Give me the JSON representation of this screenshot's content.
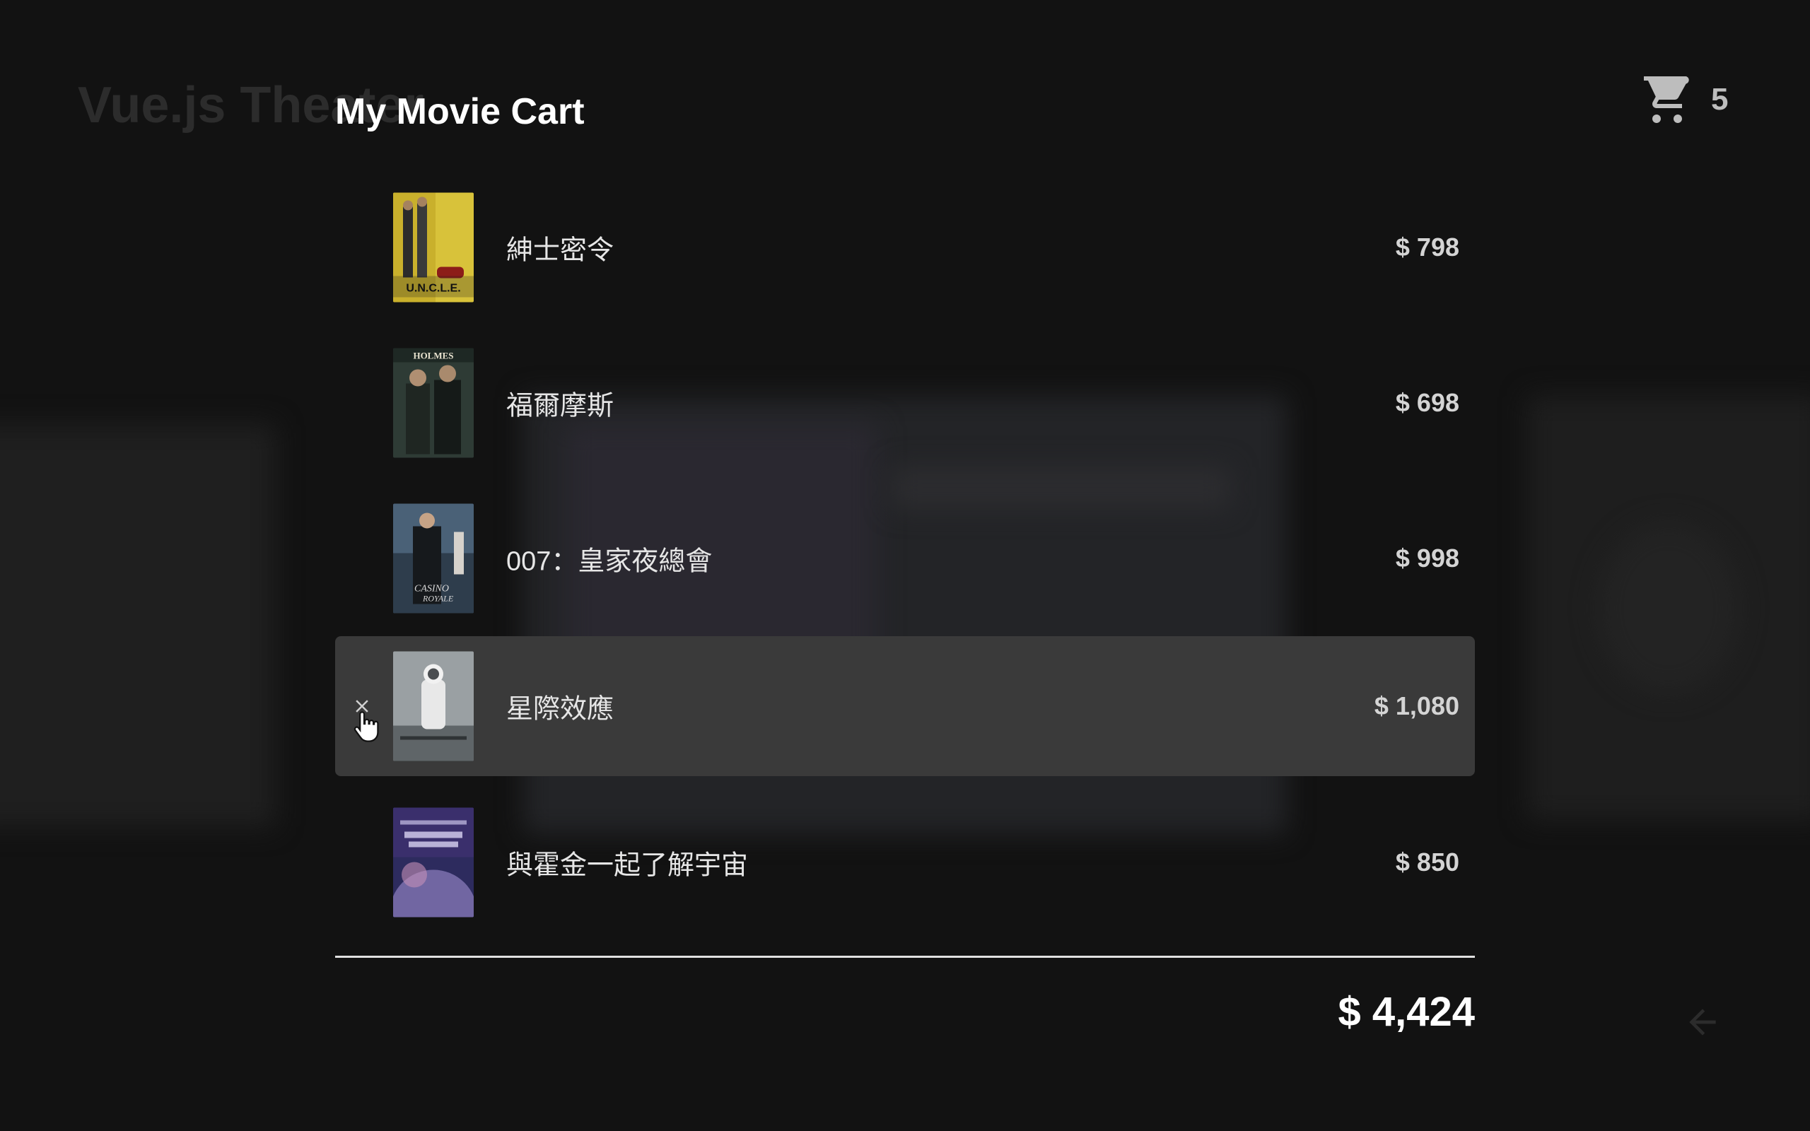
{
  "background": {
    "app_title": "Vue.js Theater",
    "back_icon": "arrow-left-icon"
  },
  "cart": {
    "title": "My Movie Cart",
    "cart_icon": "shopping-cart-icon",
    "count": "5",
    "items": [
      {
        "title": "紳士密令",
        "price": "$ 798",
        "poster_icon": "movie-poster-uncle"
      },
      {
        "title": "福爾摩斯",
        "price": "$ 698",
        "poster_icon": "movie-poster-holmes"
      },
      {
        "title": "007：皇家夜總會",
        "price": "$ 998",
        "poster_icon": "movie-poster-casino-royale"
      },
      {
        "title": "星際效應",
        "price": "$ 1,080",
        "poster_icon": "movie-poster-interstellar",
        "hovered": true,
        "remove_icon": "close-icon"
      },
      {
        "title": "與霍金一起了解宇宙",
        "price": "$ 850",
        "poster_icon": "movie-poster-hawking"
      }
    ],
    "total": "$ 4,424"
  },
  "colors": {
    "background": "#121212",
    "row_hover": "#3a3a3a",
    "text": "#ffffff",
    "muted": "#bdbdbd"
  }
}
